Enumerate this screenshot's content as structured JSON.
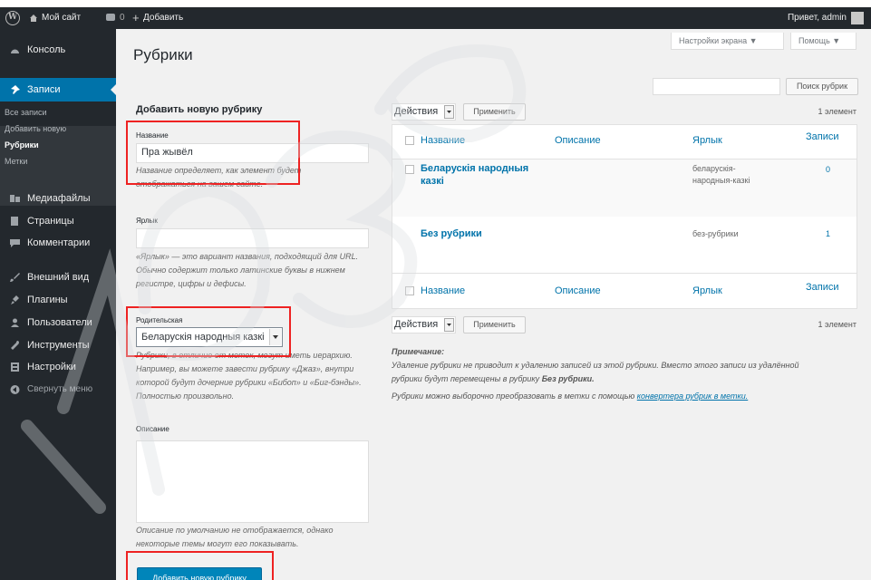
{
  "adminbar": {
    "site_name": "Мой сайт",
    "comments_count": "0",
    "new_label": "Добавить",
    "greeting": "Привет, admin",
    "icons": [
      "wordpress-logo-icon",
      "home-icon",
      "comment-bubble-icon",
      "plus-icon",
      "avatar"
    ]
  },
  "sidebar": {
    "items": [
      {
        "label": "Консоль",
        "icon": "dashboard-icon"
      },
      {
        "label": "Записи",
        "icon": "pin-icon"
      },
      {
        "label": "Медиафайлы",
        "icon": "media-icon"
      },
      {
        "label": "Страницы",
        "icon": "pages-icon"
      },
      {
        "label": "Комментарии",
        "icon": "comment-icon"
      },
      {
        "label": "Внешний вид",
        "icon": "brush-icon"
      },
      {
        "label": "Плагины",
        "icon": "plugin-icon"
      },
      {
        "label": "Пользователи",
        "icon": "users-icon"
      },
      {
        "label": "Инструменты",
        "icon": "wrench-icon"
      },
      {
        "label": "Настройки",
        "icon": "settings-icon"
      },
      {
        "label": "Свернуть меню",
        "icon": "collapse-icon"
      }
    ],
    "submenu": [
      "Все записи",
      "Добавить новую",
      "Рубрики",
      "Метки"
    ]
  },
  "screen_options": "Настройки экрана ▼",
  "help": "Помощь ▼",
  "page_title": "Рубрики",
  "search_button": "Поиск рубрик",
  "form": {
    "heading": "Добавить новую рубрику",
    "name_label": "Название",
    "name_value": "Пра жывёл",
    "name_help": "Название определяет, как элемент будет отображаться на вашем сайте.",
    "slug_label": "Ярлык",
    "slug_help_1": "«Ярлык» — это вариант названия, подходящий для URL.",
    "slug_help_2": "Обычно содержит только латинские буквы в нижнем",
    "slug_help_3": "регистре, цифры и дефисы.",
    "parent_label": "Родительская",
    "parent_value": "Беларускія народныя казкі",
    "parent_help_1": "Рубрики, в отличие от меток, могут иметь иерархию.",
    "parent_help_2": "Например, вы можете завести рубрику «Джаз», внутри",
    "parent_help_3": "которой будут дочерние рубрики «Бибоп» и «Биг-бэнды».",
    "parent_help_4": "Полностью произвольно.",
    "description_label": "Описание",
    "description_help_1": "Описание по умолчанию не отображается, однако",
    "description_help_2": "некоторые темы могут его показывать.",
    "submit": "Добавить новую рубрику"
  },
  "bulk": {
    "actions": "Действия",
    "apply": "Применить",
    "count": "1 элемент"
  },
  "table": {
    "columns": [
      "Название",
      "Описание",
      "Ярлык",
      "Записи"
    ],
    "rows": [
      {
        "name_1": "Беларускія народныя",
        "name_2": "казкі",
        "slug_1": "беларускія-",
        "slug_2": "народныя-казкі",
        "count": "0"
      },
      {
        "name_1": "Без рубрики",
        "name_2": "",
        "slug_1": "без-рубрики",
        "slug_2": "",
        "count": "1"
      }
    ]
  },
  "notes": {
    "heading": "Примечание:",
    "line1": "Удаление рубрики не приводит к удалению записей из этой рубрики. Вместо этого записи из удалённой",
    "line2_pre": "рубрики будут перемещены в рубрику ",
    "line2_bold": "Без рубрики.",
    "line3_pre": "Рубрики можно выборочно преобразовать в метки с помощью ",
    "line3_link": "конвертера рубрик в метки."
  },
  "colors": {
    "adminbar": "#23282d",
    "active_menu": "#0073aa",
    "primary_button": "#0085ba",
    "highlight_box": "#e22222",
    "link": "#0073aa"
  }
}
